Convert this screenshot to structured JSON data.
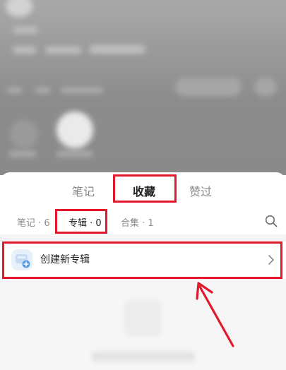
{
  "tabs": [
    {
      "label": "笔记",
      "active": false
    },
    {
      "label": "收藏",
      "active": true
    },
    {
      "label": "赞过",
      "active": false
    }
  ],
  "subtabs": [
    {
      "label": "笔记 · 6",
      "active": false
    },
    {
      "label": "专辑 · 0",
      "active": true
    },
    {
      "label": "合集 · 1",
      "active": false
    }
  ],
  "create_album": {
    "label": "创建新专辑",
    "icon": "album-add-icon"
  },
  "icons": {
    "search": "search-icon",
    "chevron": "chevron-right-icon",
    "arrow": "annotation-arrow-icon"
  },
  "colors": {
    "highlight": "#e2182d",
    "active_text": "#222222",
    "inactive_text": "#8a8a8a",
    "icon_blue": "#e8f1fb"
  }
}
